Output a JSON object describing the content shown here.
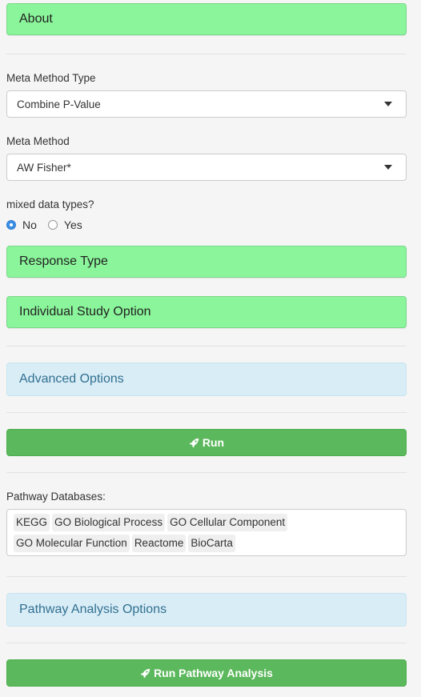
{
  "panels": {
    "about": "About",
    "response_type": "Response Type",
    "individual_study_option": "Individual Study Option",
    "advanced_options": "Advanced Options",
    "pathway_analysis_options": "Pathway Analysis Options"
  },
  "meta_method_type": {
    "label": "Meta Method Type",
    "selected": "Combine P-Value"
  },
  "meta_method": {
    "label": "Meta Method",
    "selected": "AW Fisher*"
  },
  "mixed_data_types": {
    "label": "mixed data types?",
    "options": [
      "No",
      "Yes"
    ],
    "selected": "No"
  },
  "buttons": {
    "run": "Run",
    "run_pathway": "Run Pathway Analysis"
  },
  "pathway_databases": {
    "label": "Pathway Databases:",
    "tags": [
      "KEGG",
      "GO Biological Process",
      "GO Cellular Component",
      "GO Molecular Function",
      "Reactome",
      "BioCarta"
    ]
  },
  "colors": {
    "panel_green": "#8af59a",
    "panel_blue": "#d9edf7",
    "button_green": "#5cb85c",
    "radio_checked": "#3a8ee6"
  },
  "icons": {
    "run": "rocket-icon",
    "select_caret": "caret-down-icon"
  }
}
